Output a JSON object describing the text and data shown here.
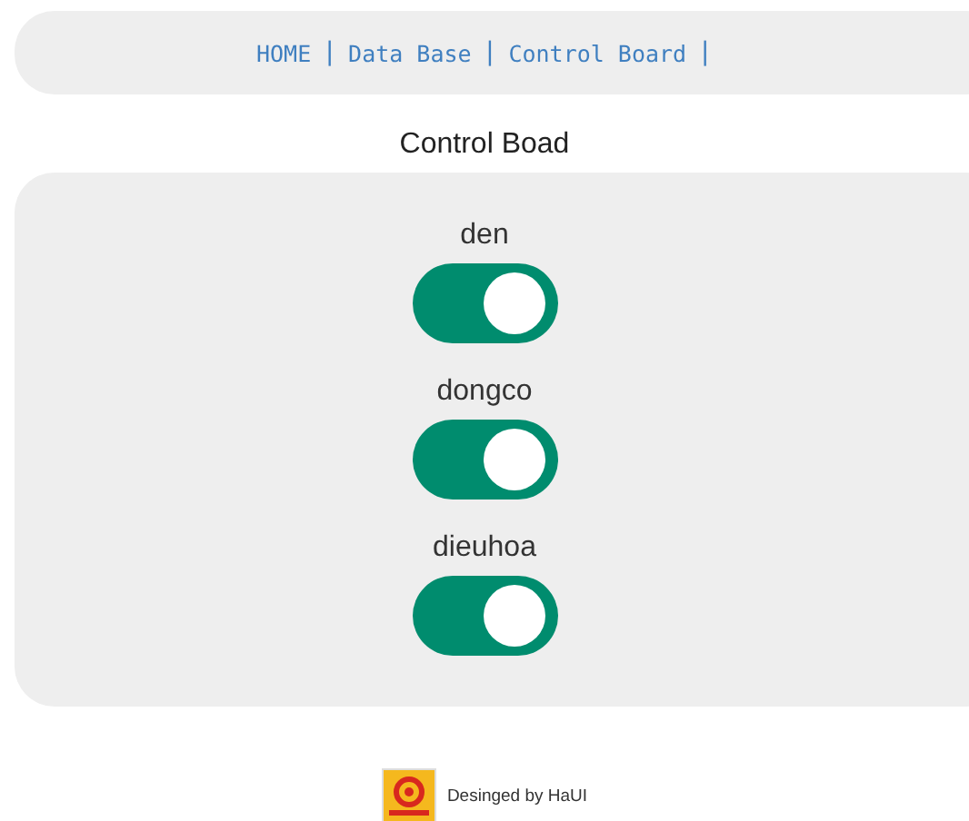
{
  "nav": [
    {
      "label": "HOME",
      "separator": "|"
    },
    {
      "label": "Data Base",
      "separator": "|"
    },
    {
      "label": "Control Board",
      "separator": "|"
    }
  ],
  "title": "Control Boad",
  "devices": [
    {
      "name": "den",
      "on": true
    },
    {
      "name": "dongco",
      "on": true
    },
    {
      "name": "dieuhoa",
      "on": true
    }
  ],
  "footer": {
    "text": "Desinged by HaUI"
  }
}
